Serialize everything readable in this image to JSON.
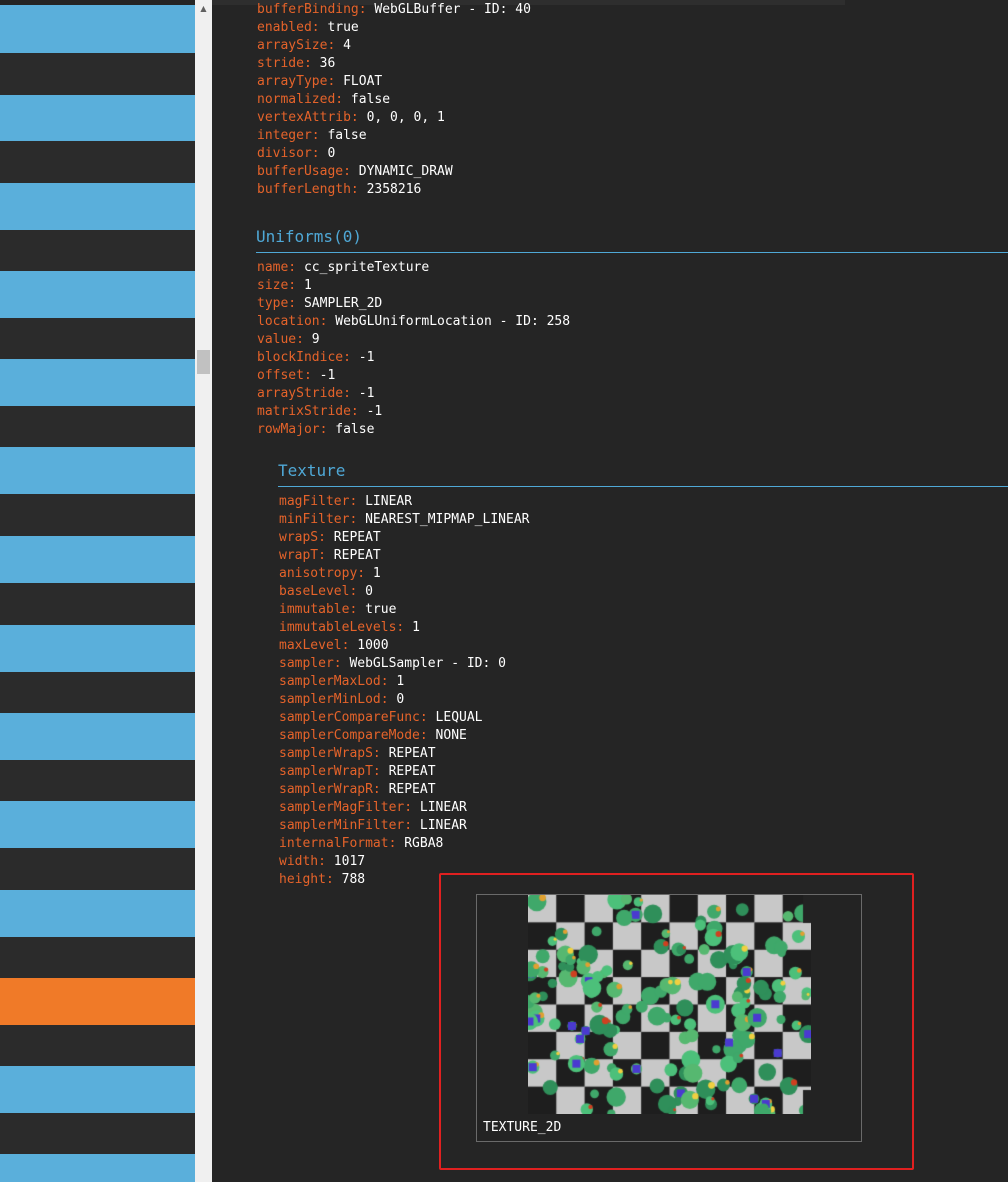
{
  "colors": {
    "stripe_blue": "#5aafdb",
    "stripe_dark": "#2b2b2b",
    "stripe_orange": "#f07a28",
    "key": "#e5632a",
    "value": "#ffffff",
    "section": "#4fa8d6",
    "highlight": "#e02020"
  },
  "command_list": {
    "stripes": [
      "blue",
      "dark",
      "blue",
      "dark",
      "blue",
      "dark",
      "blue",
      "dark",
      "blue",
      "dark",
      "blue",
      "dark",
      "blue",
      "dark",
      "blue",
      "dark",
      "blue",
      "dark",
      "blue",
      "dark",
      "blue",
      "dark",
      "orange",
      "dark",
      "blue",
      "dark",
      "blue"
    ],
    "selected_index": 22
  },
  "scrollbar": {
    "up_arrow": "▲"
  },
  "attribute": {
    "rows": [
      {
        "key": "bufferBinding:",
        "value": "WebGLBuffer - ID: 40"
      },
      {
        "key": "enabled:",
        "value": "true"
      },
      {
        "key": "arraySize:",
        "value": "4"
      },
      {
        "key": "stride:",
        "value": "36"
      },
      {
        "key": "arrayType:",
        "value": "FLOAT"
      },
      {
        "key": "normalized:",
        "value": "false"
      },
      {
        "key": "vertexAttrib:",
        "value": "0, 0, 0, 1"
      },
      {
        "key": "integer:",
        "value": "false"
      },
      {
        "key": "divisor:",
        "value": "0"
      },
      {
        "key": "bufferUsage:",
        "value": "DYNAMIC_DRAW"
      },
      {
        "key": "bufferLength:",
        "value": "2358216"
      }
    ]
  },
  "uniforms": {
    "title": "Uniforms(0)",
    "rows": [
      {
        "key": "name:",
        "value": "cc_spriteTexture"
      },
      {
        "key": "size:",
        "value": "1"
      },
      {
        "key": "type:",
        "value": "SAMPLER_2D"
      },
      {
        "key": "location:",
        "value": "WebGLUniformLocation - ID: 258"
      },
      {
        "key": "value:",
        "value": "9"
      },
      {
        "key": "blockIndice:",
        "value": "-1"
      },
      {
        "key": "offset:",
        "value": "-1"
      },
      {
        "key": "arrayStride:",
        "value": "-1"
      },
      {
        "key": "matrixStride:",
        "value": "-1"
      },
      {
        "key": "rowMajor:",
        "value": "false"
      }
    ]
  },
  "texture": {
    "title": "Texture",
    "rows": [
      {
        "key": "magFilter:",
        "value": "LINEAR"
      },
      {
        "key": "minFilter:",
        "value": "NEAREST_MIPMAP_LINEAR"
      },
      {
        "key": "wrapS:",
        "value": "REPEAT"
      },
      {
        "key": "wrapT:",
        "value": "REPEAT"
      },
      {
        "key": "anisotropy:",
        "value": "1"
      },
      {
        "key": "baseLevel:",
        "value": "0"
      },
      {
        "key": "immutable:",
        "value": "true"
      },
      {
        "key": "immutableLevels:",
        "value": "1"
      },
      {
        "key": "maxLevel:",
        "value": "1000"
      },
      {
        "key": "sampler:",
        "value": "WebGLSampler - ID: 0"
      },
      {
        "key": "samplerMaxLod:",
        "value": "1"
      },
      {
        "key": "samplerMinLod:",
        "value": "0"
      },
      {
        "key": "samplerCompareFunc:",
        "value": "LEQUAL"
      },
      {
        "key": "samplerCompareMode:",
        "value": "NONE"
      },
      {
        "key": "samplerWrapS:",
        "value": "REPEAT"
      },
      {
        "key": "samplerWrapT:",
        "value": "REPEAT"
      },
      {
        "key": "samplerWrapR:",
        "value": "REPEAT"
      },
      {
        "key": "samplerMagFilter:",
        "value": "LINEAR"
      },
      {
        "key": "samplerMinFilter:",
        "value": "LINEAR"
      },
      {
        "key": "internalFormat:",
        "value": "RGBA8"
      },
      {
        "key": "width:",
        "value": "1017"
      },
      {
        "key": "height:",
        "value": "788"
      }
    ],
    "preview_label": "TEXTURE_2D"
  }
}
